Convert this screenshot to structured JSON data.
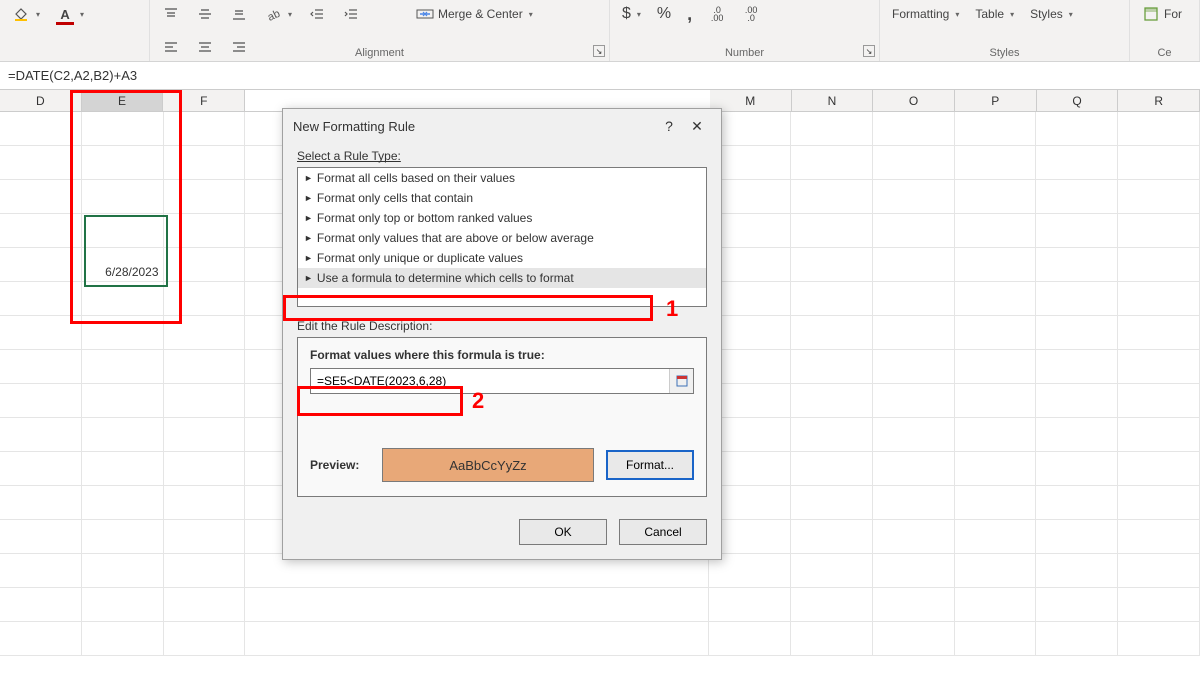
{
  "ribbon": {
    "merge_center": "Merge & Center",
    "formatting": "Formatting",
    "table": "Table",
    "styles": "Styles",
    "format_btn": "For",
    "group_alignment": "Alignment",
    "group_number": "Number",
    "group_styles": "Styles",
    "group_cells": "Ce",
    "percent": "%",
    "comma": ",",
    "inc_dec": ".00",
    "dec_dec": ".0",
    "dollar": "$",
    "poundish": "$"
  },
  "formula_bar": "=DATE(C2,A2,B2)+A3",
  "columns": [
    "D",
    "E",
    "F",
    "",
    "",
    "",
    "M",
    "N",
    "O",
    "P",
    "Q",
    "R"
  ],
  "cell_e5": "6/28/2023",
  "dialog": {
    "title": "New Formatting Rule",
    "help": "?",
    "close": "✕",
    "select_rule_type": "Select a Rule Type:",
    "rules": [
      "Format all cells based on their values",
      "Format only cells that contain",
      "Format only top or bottom ranked values",
      "Format only values that are above or below average",
      "Format only unique or duplicate values",
      "Use a formula to determine which cells to format"
    ],
    "edit_desc": "Edit the Rule Description:",
    "formula_label": "Format values where this formula is true:",
    "formula_value": "=SE5<DATE(2023,6,28)",
    "preview_label": "Preview:",
    "preview_sample": "AaBbCcYyZz",
    "format_btn": "Format...",
    "ok": "OK",
    "cancel": "Cancel"
  },
  "annotations": {
    "one": "1",
    "two": "2"
  }
}
